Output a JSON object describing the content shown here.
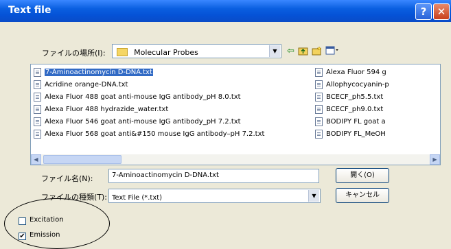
{
  "window": {
    "title": "Text file",
    "help_glyph": "?",
    "close_glyph": "✕"
  },
  "look_in": {
    "label": "ファイルの場所(I):",
    "value": "Molecular Probes",
    "icons": [
      "back-icon",
      "up-folder-icon",
      "new-folder-icon",
      "view-menu-icon"
    ]
  },
  "files": {
    "column1": [
      "7-Aminoactinomycin D-DNA.txt",
      "Acridine orange-DNA.txt",
      "Alexa Fluor 488 goat anti-mouse IgG antibody_pH 8.0.txt",
      "Alexa Fluor 488 hydrazide_water.txt",
      "Alexa Fluor 546 goat anti-mouse IgG antibody_pH 7.2.txt",
      "Alexa Fluor 568 goat anti&#150 mouse IgG antibody–pH 7.2.txt"
    ],
    "column2": [
      "Alexa Fluor 594 g",
      "Allophycocyanin-p",
      "BCECF_ph5.5.txt",
      "BCECF_ph9.0.txt",
      "BODIPY FL goat a",
      "BODIPY FL_MeOH"
    ],
    "selected": "7-Aminoactinomycin D-DNA.txt"
  },
  "file_name": {
    "label": "ファイル名(N):",
    "value": "7-Aminoactinomycin D-DNA.txt"
  },
  "file_type": {
    "label": "ファイルの種類(T):",
    "value": "Text File (*.txt)"
  },
  "buttons": {
    "open": "開く(O)",
    "cancel": "キャンセル"
  },
  "options": {
    "excitation": {
      "label": "Excitation",
      "checked": false
    },
    "emission": {
      "label": "Emission",
      "checked": true
    },
    "check_mark": "✔"
  },
  "scroll": {
    "left_arrow": "◀",
    "right_arrow": "▶",
    "dropdown_arrow": "▼"
  }
}
